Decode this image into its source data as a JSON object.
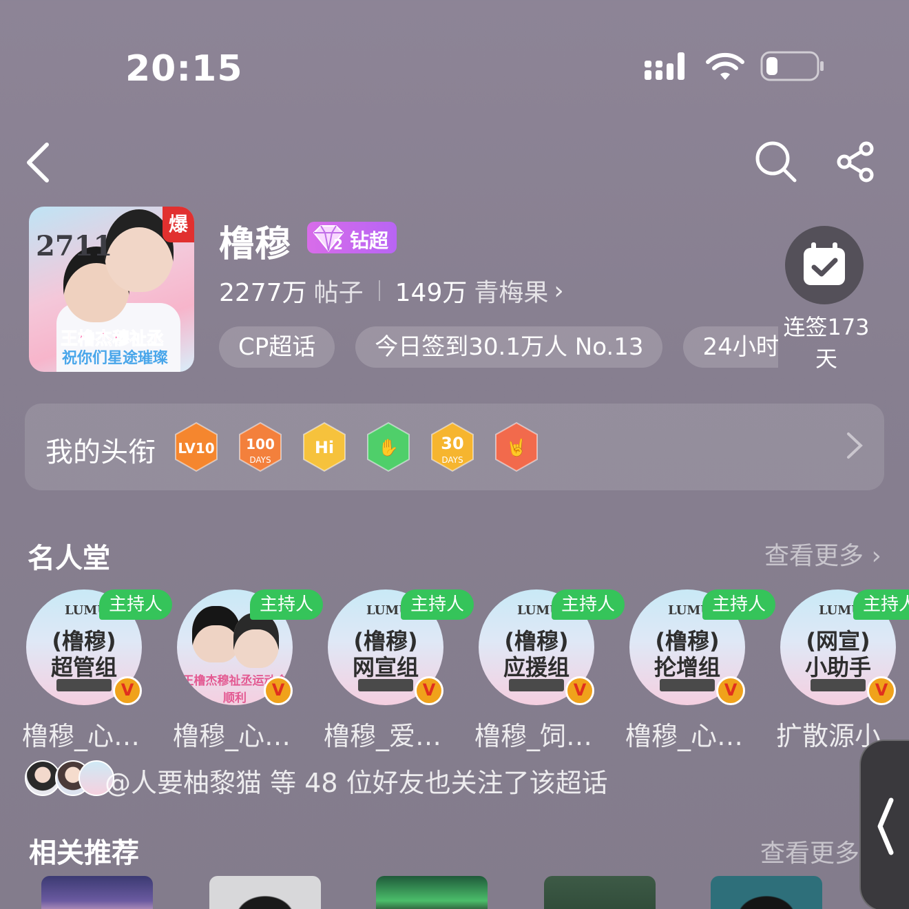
{
  "status_bar": {
    "time": "20:15"
  },
  "header": {
    "topic_name": "橹穆",
    "badge": {
      "level": "2",
      "label": "钻超"
    },
    "cover": {
      "explode_tag": "爆",
      "number": "2711",
      "caption_line1": "王橹杰穆祉丞",
      "caption_line2": "祝你们星途璀璨"
    },
    "posts_count": "2277万",
    "posts_label": "帖子",
    "plums_count": "149万",
    "plums_label": "青梅果",
    "chips": [
      "CP超话",
      "今日签到30.1万人 No.13",
      "24小时"
    ],
    "checkin_label": "连签173天"
  },
  "titles": {
    "label": "我的头衔",
    "badges": [
      {
        "name": "level-badge",
        "text": "LV10",
        "color": "#f5862e"
      },
      {
        "name": "100-days-badge",
        "text": "100",
        "sub": "DAYS",
        "color": "#f3803c"
      },
      {
        "name": "hi-badge",
        "text": "Hi",
        "color": "#f6c23c"
      },
      {
        "name": "hand-badge",
        "text": "✋",
        "color": "#4fcf6a"
      },
      {
        "name": "30-days-badge",
        "text": "30",
        "sub": "DAYS",
        "color": "#f6b52f"
      },
      {
        "name": "rock-hand-badge",
        "text": "🤘",
        "color": "#f26a4c"
      }
    ]
  },
  "hall_of_fame": {
    "title": "名人堂",
    "more": "查看更多",
    "host_tag": "主持人",
    "members": [
      {
        "brand": "LUMU",
        "line1": "(橹穆)",
        "line2": "超管组",
        "name": "橹穆_心…"
      },
      {
        "photo": true,
        "caption": "王橹杰穆祉丞运动会顺利",
        "name": "橹穆_心…"
      },
      {
        "brand": "LUMU",
        "line1": "(橹穆)",
        "line2": "网宣组",
        "name": "橹穆_爱…"
      },
      {
        "brand": "LUMU",
        "line1": "(橹穆)",
        "line2": "应援组",
        "name": "橹穆_饲…"
      },
      {
        "brand": "LUMU",
        "line1": "(橹穆)",
        "line2": "抡增组",
        "name": "橹穆_心…"
      },
      {
        "brand": "LUMU",
        "line1": "(网宣)",
        "line2": "小助手",
        "name": "扩散源小…"
      }
    ]
  },
  "friends": {
    "text": "@人要柚黎猫 等 48 位好友也关注了该超话"
  },
  "related": {
    "title": "相关推荐",
    "more": "查看更多"
  }
}
